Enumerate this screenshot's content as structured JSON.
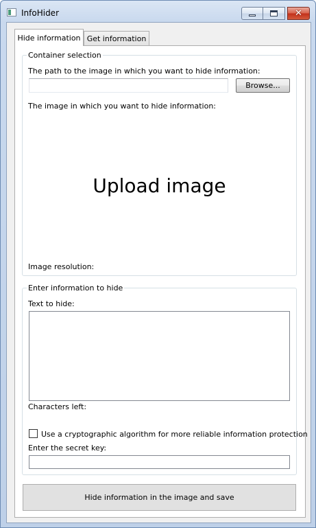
{
  "window": {
    "title": "InfoHider",
    "controls": {
      "minimize": "minimize-icon",
      "maximize": "maximize-icon",
      "close": "close-icon",
      "close_glyph": "✕"
    }
  },
  "tabs": [
    {
      "label": "Hide information",
      "active": true
    },
    {
      "label": "Get information",
      "active": false
    }
  ],
  "container_selection": {
    "title": "Container selection",
    "path_label": "The path to the image in which you want to hide information:",
    "path_value": "",
    "browse_label": "Browse...",
    "image_label": "The image in which you want to hide information:",
    "upload_text": "Upload image",
    "resolution_label": "Image resolution:"
  },
  "hide_info": {
    "title": "Enter information to hide",
    "text_label": "Text to hide:",
    "text_value": "",
    "chars_left_label": "Characters left:",
    "crypto_checkbox_label": "Use a cryptographic algorithm for more reliable information protection",
    "crypto_checked": false,
    "secret_key_label": "Enter the secret key:",
    "secret_key_value": ""
  },
  "action": {
    "save_label": "Hide information in the image and save"
  },
  "colors": {
    "frame": "#bed0e8",
    "client": "#f0f0f0",
    "close_button": "#c2301a"
  }
}
